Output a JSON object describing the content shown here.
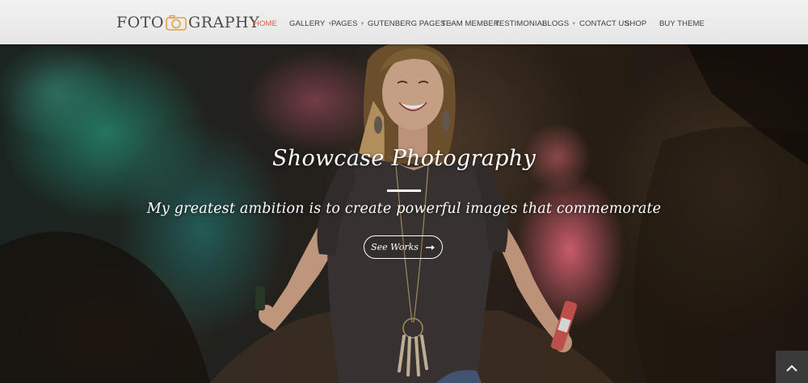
{
  "brand": {
    "logo_left": "FOTO",
    "logo_right": "GRAPHY",
    "logo_icon": "camera-icon"
  },
  "nav": [
    {
      "label": "HOME",
      "active": true,
      "has_dropdown": false
    },
    {
      "label": "GALLERY",
      "has_dropdown": true
    },
    {
      "label": "PAGES",
      "has_dropdown": true
    },
    {
      "label": "GUTENBERG PAGES",
      "has_dropdown": true
    },
    {
      "label": "TEAM MEMBER",
      "has_dropdown": false
    },
    {
      "label": "TESTIMONIAL",
      "has_dropdown": false
    },
    {
      "label": "BLOGS",
      "has_dropdown": true
    },
    {
      "label": "CONTACT US",
      "has_dropdown": false
    },
    {
      "label": "SHOP",
      "has_dropdown": false
    },
    {
      "label": "BUY THEME",
      "has_dropdown": false
    }
  ],
  "hero": {
    "title": "Showcase Photography",
    "subtitle": "My greatest ambition is to create powerful images that commemorate",
    "cta_label": "See Works",
    "cta_icon": "arrow-right-icon"
  },
  "scroll_top_icon": "chevron-up-icon",
  "colors": {
    "accent": "#e35a3f",
    "header_bg": "#f0f0f0",
    "scroll_top_bg": "#3a3a3a"
  }
}
